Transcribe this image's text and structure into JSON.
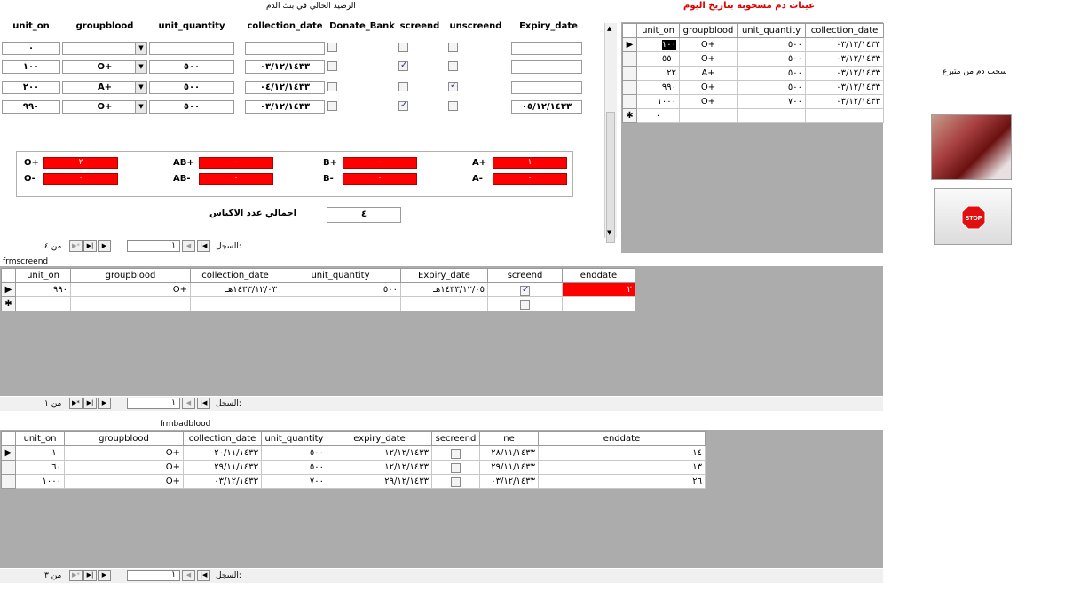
{
  "top_title_left": "الرصيد الحالي في بنك الدم",
  "top_title_right": "عينات دم مسحوبة بتاريخ اليوم",
  "form": {
    "headers": [
      "unit_on",
      "groupblood",
      "unit_quantity",
      "collection_date",
      "Donate_Bank",
      "screend",
      "unscreend",
      "Expiry_date"
    ],
    "rows": [
      {
        "unit_on": "٠",
        "groupblood": "",
        "unit_quantity": "",
        "collection_date": "",
        "donate": false,
        "screend": false,
        "unscreend": false,
        "expiry": ""
      },
      {
        "unit_on": "١٠٠",
        "groupblood": "O+",
        "unit_quantity": "٥٠٠",
        "collection_date": "٠٣/١٢/١٤٣٣",
        "donate": false,
        "screend": true,
        "unscreend": false,
        "expiry": ""
      },
      {
        "unit_on": "٢٠٠",
        "groupblood": "A+",
        "unit_quantity": "٥٠٠",
        "collection_date": "٠٤/١٢/١٤٣٣",
        "donate": false,
        "screend": false,
        "unscreend": true,
        "expiry": ""
      },
      {
        "unit_on": "٩٩٠",
        "groupblood": "O+",
        "unit_quantity": "٥٠٠",
        "collection_date": "٠٣/١٢/١٤٣٣",
        "donate": false,
        "screend": true,
        "unscreend": false,
        "expiry": "٠٥/١٢/١٤٣٣"
      }
    ],
    "summary": {
      "O+": {
        "label": "O+",
        "value": "٢"
      },
      "O-": {
        "label": "O-",
        "value": "٠"
      },
      "AB+": {
        "label": "AB+",
        "value": "٠"
      },
      "AB-": {
        "label": "AB-",
        "value": "٠"
      },
      "B+": {
        "label": "B+",
        "value": "٠"
      },
      "B-": {
        "label": "B-",
        "value": "٠"
      },
      "A+": {
        "label": "A+",
        "value": "١"
      },
      "A-": {
        "label": "A-",
        "value": "٠"
      }
    },
    "total_label": "اجمالي عدد الاكياس",
    "total_value": "٤",
    "nav": {
      "record_label": "السجل:",
      "current": "١",
      "of_label": "من ٤"
    }
  },
  "today_grid": {
    "headers": [
      "unit_on",
      "groupblood",
      "unit_quantity",
      "collection_date"
    ],
    "rows": [
      [
        "١٠٠",
        "O+",
        "٥٠٠",
        "٠٣/١٢/١٤٣٣"
      ],
      [
        "٥٥٠",
        "O+",
        "٥٠٠",
        "٠٣/١٢/١٤٣٣"
      ],
      [
        "٢٢",
        "A+",
        "٥٠٠",
        "٠٣/١٢/١٤٣٣"
      ],
      [
        "٩٩٠",
        "O+",
        "٥٠٠",
        "٠٣/١٢/١٤٣٣"
      ],
      [
        "١٠٠٠",
        "O+",
        "٧٠٠",
        "٠٣/١٢/١٤٣٣"
      ]
    ],
    "new_row_value": "٠"
  },
  "side": {
    "withdraw_label": "سحب دم من متبرع",
    "stop_label": "STOP",
    "image_icon": "blood-bag-icon"
  },
  "frmscreend": {
    "title": "frmscreend",
    "headers": [
      "unit_on",
      "groupblood",
      "collection_date",
      "unit_quantity",
      "Expiry_date",
      "screend",
      "enddate"
    ],
    "rows": [
      {
        "unit_on": "٩٩٠",
        "groupblood": "O+",
        "collection_date": "١٤٣٣/١٢/٠٣هـ",
        "unit_quantity": "٥٠٠",
        "expiry": "١٤٣٣/١٢/٠٥هـ",
        "screend": true,
        "enddate": "٢"
      }
    ],
    "nav": {
      "record_label": "السجل:",
      "current": "١",
      "of_label": "من ١"
    }
  },
  "frmbadblood": {
    "title": "frmbadblood",
    "headers": [
      "unit_on",
      "groupblood",
      "collection_date",
      "unit_quantity",
      "expiry_date",
      "secreend",
      "ne",
      "enddate"
    ],
    "rows": [
      [
        "١٠",
        "O+",
        "٢٠/١١/١٤٣٣",
        "٥٠٠",
        "١٢/١٢/١٤٣٣",
        "",
        "٢٨/١١/١٤٣٣",
        "١٤"
      ],
      [
        "٦٠",
        "O+",
        "٢٩/١١/١٤٣٣",
        "٥٠٠",
        "١٢/١٢/١٤٣٣",
        "",
        "٢٩/١١/١٤٣٣",
        "١٣"
      ],
      [
        "١٠٠٠",
        "O+",
        "٠٣/١٢/١٤٣٣",
        "٧٠٠",
        "٢٩/١٢/١٤٣٣",
        "",
        "٠٣/١٢/١٤٣٣",
        "٢٦"
      ]
    ],
    "nav": {
      "record_label": "السجل:",
      "current": "١",
      "of_label": "من ٣"
    }
  },
  "colors": {
    "red": "#ff0000",
    "gray": "#acacac",
    "title_red": "#e00000"
  }
}
